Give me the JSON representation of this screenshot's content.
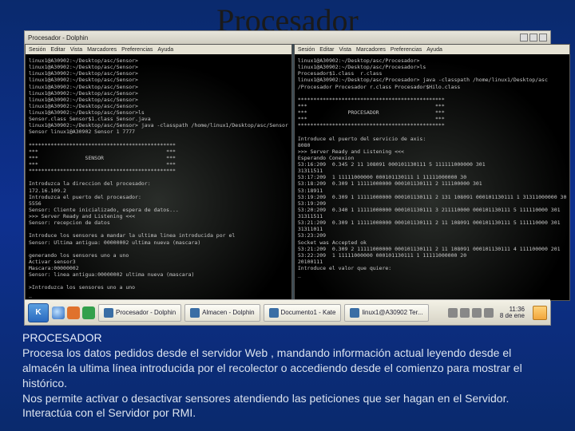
{
  "title": "Procesador",
  "window_title": "Procesador - Dolphin",
  "left_menu": {
    "items": [
      "Sesión",
      "Editar",
      "Vista",
      "Marcadores",
      "Preferencias",
      "Ayuda"
    ]
  },
  "right_menu": {
    "items": [
      "Sesión",
      "Editar",
      "Vista",
      "Marcadores",
      "Preferencias",
      "Ayuda"
    ]
  },
  "left_term": "linux1@A30902:~/Desktop/asc/Sensor>\nlinux1@A30902:~/Desktop/asc/Sensor>\nlinux1@A30902:~/Desktop/asc/Sensor>\nlinux1@A30902:~/Desktop/asc/Sensor>\nlinux1@A30902:~/Desktop/asc/Sensor>\nlinux1@A30902:~/Desktop/asc/Sensor>\nlinux1@A30902:~/Desktop/asc/Sensor>\nlinux1@A30902:~/Desktop/asc/Sensor>\nlinux1@A30902:~/Desktop/asc/Sensor>ls\nSensor.class Sensor$1.class Sensor.java\nlinux1@A30902:~/Desktop/asc/Sensor> java -classpath /home/linux1/Desktop/asc/Sensor\nSensor linux1@A30902 Sensor 1 7777\n\n***********************************************\n***                                         ***\n***               SENSOR                    ***\n***                                         ***\n***********************************************\n\nIntroduzca la direccion del procesador:\n172.16.109.2\nIntroduzca el puerto del procesador:\n5556\nSensor: Cliente inicializado, espera de datos...\n>>> Server Ready and Listening <<<\nSensor: recepcion de datos\n\nIntroduce los sensores a mandar la ultima linea introducida por el\nSensor: Ultima antigua: 00000002 ultima nueva (mascara)\n\ngenerando los sensores uno a uno\nActivar sensor3\nMascara:00000002\nSensor: linea antigua:00000002 ultima nueva (mascara)\n\n>Introduzca los sensores uno a uno\n_",
  "right_term": "linux1@A30902:~/Desktop/asc/Procesador>\nlinux1@A30902:~/Desktop/asc/Procesador>ls\nProcesador$1.class  r.class\nlinux1@A30902:~/Desktop/asc/Procesador> java -classpath /home/linux1/Desktop/asc\n/Procesador Procesador r.class Procesador$Hilo.class\n\n***********************************************\n***                                         ***\n***             PROCESADOR                  ***\n***                                         ***\n***********************************************\n\nIntroduce el puerto del servicio de axis:\n8080\n>>> Server Ready and Listening <<<\nEsperando Conexion\n53:16:209  0.345 2 11 108091 000101130111 5 111111000000 301\n31311511\n53:17:209  1 11111000000 000101130111 1 11111000000 30\n53:18:209  0.309 1 11111000000 000101130111 2 111100000 301\n53:18911\n53:19:209  0.309 1 11111000000 000101130111 2 131 108091 000101130111 1 31311000000 30\n53:19:209\n53:20:209  0.340 1 11111000000 000101130111 3 211110000 000101130111 5 111110000 301\n31311511\n53:21:209  0.309 1 11111000000 000101130111 2 11 108091 000101130111 5 111110000 301\n31311011\n53:23:209\nSocket was Accepted ok\n53:21:209  0.309 2 11111000000 000101130111 2 11 108091 000101130111 4 111100000 201\n53:22:209  1 11111000000 000101130111 1 11111000000 20\n20100111\nIntroduce el valor que quiere:\n_",
  "taskbar": {
    "apps": [
      {
        "label": "Procesador - Dolphin"
      },
      {
        "label": "Almacen - Dolphin"
      },
      {
        "label": "Documento1 - Kate"
      },
      {
        "label": "linux1@A30902  Ter..."
      }
    ],
    "clock": {
      "time": "11:36",
      "date": "8 de ene"
    }
  },
  "caption": {
    "hdr": "PROCESADOR",
    "p1": "Procesa los datos pedidos desde el servidor Web , mandando información actual leyendo desde el almacén la ultima línea introducida por el recolector o accediendo  desde el comienzo para mostrar el histórico.",
    "p2": "Nos permite  activar o desactivar sensores  atendiendo las peticiones que ser hagan en el Servidor.",
    "p3": "Interactúa con el Servidor por  RMI."
  }
}
